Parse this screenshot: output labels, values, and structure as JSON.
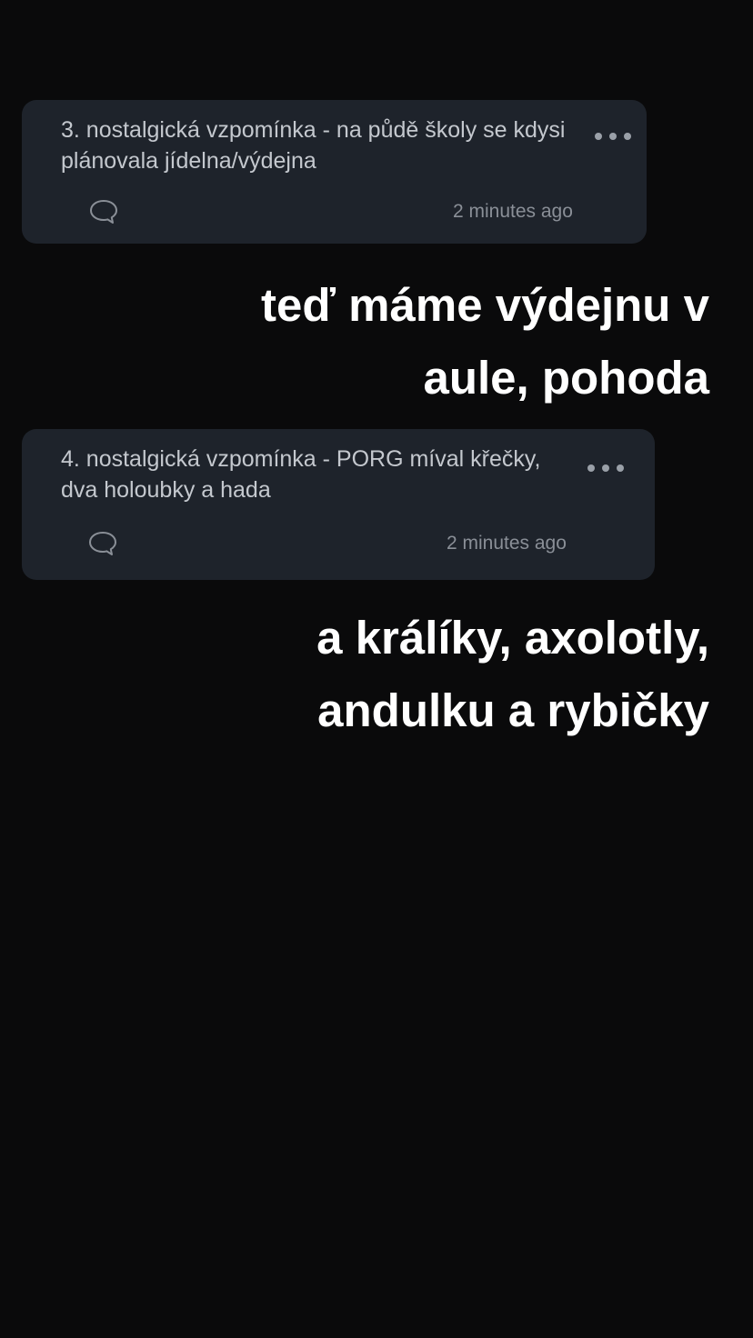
{
  "posts": [
    {
      "text": "3. nostalgická vzpomínka - na půdě školy se kdysi plánovala jídelna/výdejna",
      "timestamp": "2 minutes ago"
    },
    {
      "text": "4. nostalgická vzpomínka - PORG míval křečky, dva holoubky a hada",
      "timestamp": "2 minutes ago"
    }
  ],
  "captions": [
    {
      "lines": [
        "teď máme výdejnu v",
        "aule, pohoda"
      ]
    },
    {
      "lines": [
        "a králíky, axolotly,",
        "andulku a rybičky"
      ]
    }
  ],
  "icons": {
    "comment": "speech-bubble-outline",
    "more": "horizontal-ellipsis"
  },
  "colors": {
    "background": "#0a0a0b",
    "card": "#1e232b",
    "post_text": "#c4c8ce",
    "meta_text": "#8a8f97",
    "caption_text": "#ffffff"
  }
}
